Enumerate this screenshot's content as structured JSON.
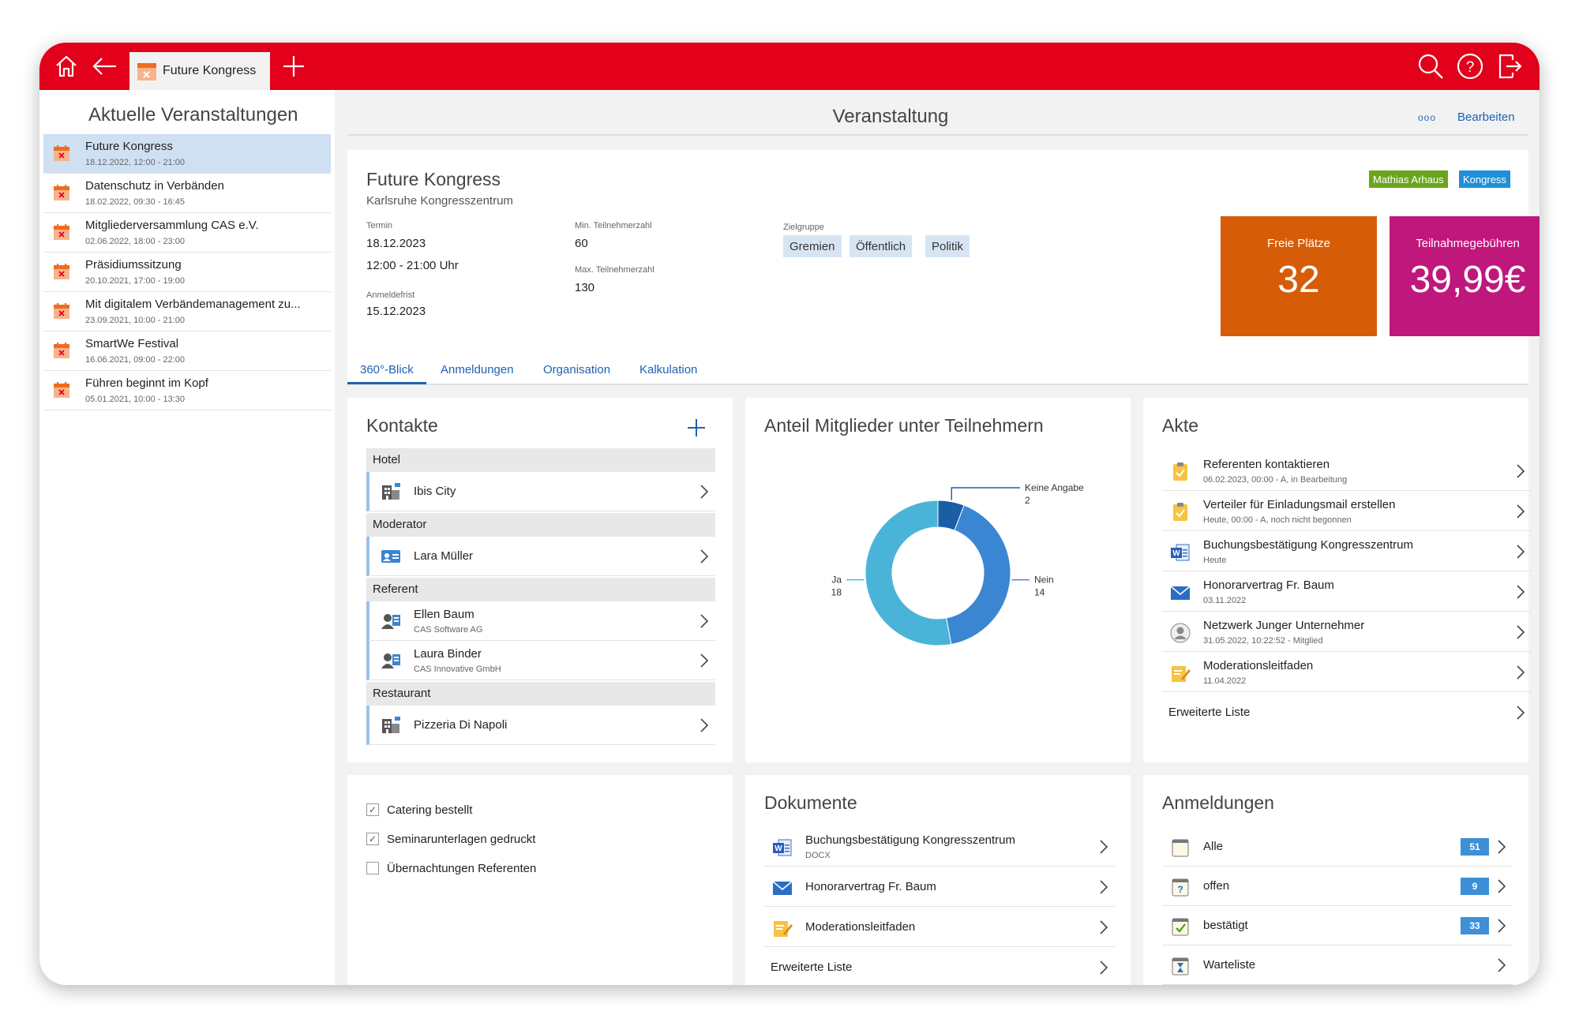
{
  "topbar": {
    "tab_label": "Future Kongress"
  },
  "left": {
    "title": "Aktuelle Veranstaltungen",
    "events": [
      {
        "name": "Future Kongress",
        "date": "18.12.2022, 12:00 - 21:00"
      },
      {
        "name": "Datenschutz in Verbänden",
        "date": "18.02.2022, 09:30 - 16:45"
      },
      {
        "name": "Mitgliederversammlung CAS e.V.",
        "date": "02.06.2022, 18:00 - 23:00"
      },
      {
        "name": "Präsidiumssitzung",
        "date": "20.10.2021, 17:00 - 19:00"
      },
      {
        "name": "Mit digitalem Verbändemanagement zu...",
        "date": "23.09.2021, 10:00 - 21:00"
      },
      {
        "name": "SmartWe Festival",
        "date": "16.06.2021, 09:00 - 22:00"
      },
      {
        "name": "Führen beginnt im Kopf",
        "date": "05.01.2021, 10:00 - 13:30"
      }
    ]
  },
  "header": {
    "title": "Veranstaltung",
    "dots": "ooo",
    "edit_label": "Bearbeiten"
  },
  "event": {
    "name": "Future Kongress",
    "location": "Karlsruhe Kongresszentrum",
    "termin_label": "Termin",
    "termin_date": "18.12.2023",
    "termin_time": "12:00 - 21:00 Uhr",
    "anmeldefrist_label": "Anmeldefrist",
    "anmeldefrist": "15.12.2023",
    "min_label": "Min. Teilnehmerzahl",
    "min": "60",
    "max_label": "Max. Teilnehmerzahl",
    "max": "130",
    "zielgruppe_label": "Zielgruppe",
    "zielgruppe": [
      "Gremien",
      "Öffentlich",
      "Politik"
    ],
    "tags": [
      {
        "label": "Mathias Arhaus",
        "color": "#6aa61c"
      },
      {
        "label": "Kongress",
        "color": "#1f8fd8"
      }
    ],
    "kpis": [
      {
        "label": "Freie Plätze",
        "value": "32",
        "color": "#d75c08"
      },
      {
        "label": "Teilnahmegebühren",
        "value": "39,99€",
        "color": "#c0177c"
      }
    ]
  },
  "tabs": [
    "360°-Blick",
    "Anmeldungen",
    "Organisation",
    "Kalkulation"
  ],
  "kontakte": {
    "title": "Kontakte",
    "groups": [
      {
        "label": "Hotel",
        "items": [
          {
            "name": "Ibis City",
            "sub": "",
            "icon": "building-icon"
          }
        ]
      },
      {
        "label": "Moderator",
        "items": [
          {
            "name": "Lara Müller",
            "sub": "",
            "icon": "contact-card-icon"
          }
        ]
      },
      {
        "label": "Referent",
        "items": [
          {
            "name": "Ellen Baum",
            "sub": "CAS Software AG",
            "icon": "person-card-icon"
          },
          {
            "name": "Laura Binder",
            "sub": "CAS Innovative GmbH",
            "icon": "person-card-icon"
          }
        ]
      },
      {
        "label": "Restaurant",
        "items": [
          {
            "name": "Pizzeria Di Napoli",
            "sub": "",
            "icon": "building-icon"
          }
        ]
      }
    ]
  },
  "anteil": {
    "title": "Anteil Mitglieder unter Teilnehmern"
  },
  "chart_data": {
    "type": "pie",
    "title": "Anteil Mitglieder unter Teilnehmern",
    "categories": [
      "Keine Angabe",
      "Nein",
      "Ja"
    ],
    "values": [
      2,
      14,
      18
    ],
    "colors": [
      "#1a5ea8",
      "#3a86d2",
      "#49b4d8"
    ]
  },
  "akte": {
    "title": "Akte",
    "items": [
      {
        "name": "Referenten kontaktieren",
        "sub": "06.02.2023, 00:00 - A, in Bearbeitung",
        "icon": "task-icon"
      },
      {
        "name": "Verteiler für Einladungsmail erstellen",
        "sub": "Heute, 00:00 - A, noch nicht begonnen",
        "icon": "task-icon"
      },
      {
        "name": "Buchungsbestätigung Kongresszentrum",
        "sub": "Heute",
        "icon": "word-document-icon"
      },
      {
        "name": "Honorarvertrag Fr. Baum",
        "sub": "03.11.2022",
        "icon": "email-icon"
      },
      {
        "name": "Netzwerk Junger Unternehmer",
        "sub": "31.05.2022, 10:22:52 - Mitglied",
        "icon": "user-circle-icon"
      },
      {
        "name": "Moderationsleitfaden",
        "sub": "11.04.2022",
        "icon": "note-icon"
      }
    ],
    "more": "Erweiterte Liste"
  },
  "checklist": {
    "items": [
      {
        "label": "Catering bestellt",
        "checked": "✓"
      },
      {
        "label": "Seminarunterlagen gedruckt",
        "checked": "✓"
      },
      {
        "label": "Übernachtungen Referenten",
        "checked": ""
      }
    ]
  },
  "dokumente": {
    "title": "Dokumente",
    "items": [
      {
        "name": "Buchungsbestätigung Kongresszentrum",
        "sub": "DOCX",
        "icon": "word-document-icon"
      },
      {
        "name": "Honorarvertrag Fr. Baum",
        "sub": "",
        "icon": "email-icon"
      },
      {
        "name": "Moderationsleitfaden",
        "sub": "",
        "icon": "note-icon"
      }
    ],
    "more": "Erweiterte Liste"
  },
  "anmeldungen": {
    "title": "Anmeldungen",
    "items": [
      {
        "name": "Alle",
        "count": "51",
        "icon": "list-icon"
      },
      {
        "name": "offen",
        "count": "9",
        "icon": "question-icon"
      },
      {
        "name": "bestätigt",
        "count": "33",
        "icon": "check-icon"
      },
      {
        "name": "Warteliste",
        "count": "",
        "icon": "hourglass-icon"
      }
    ]
  }
}
